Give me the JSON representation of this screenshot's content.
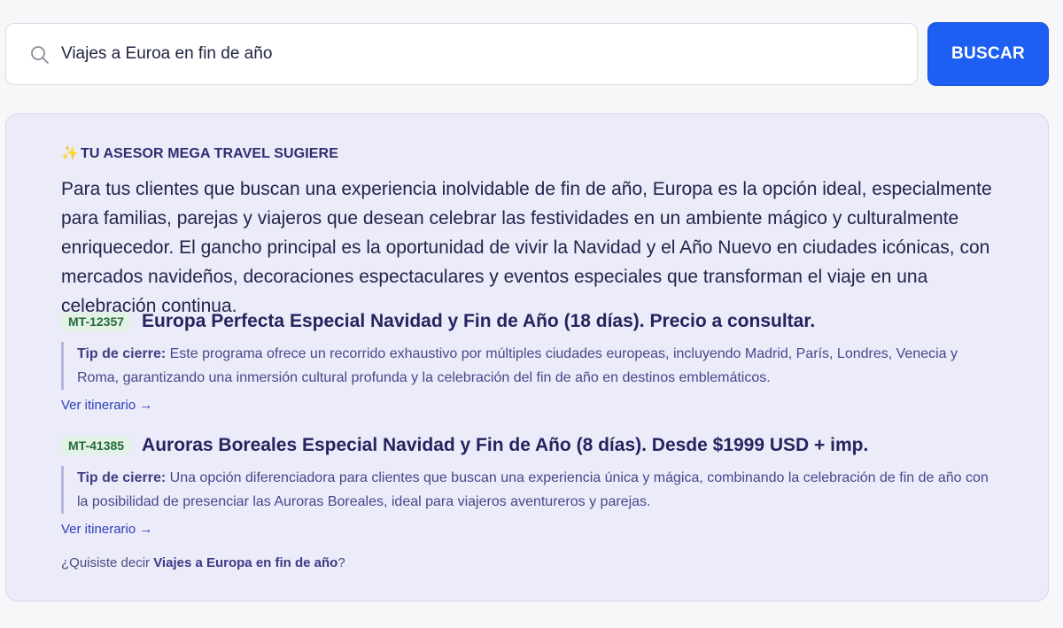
{
  "search": {
    "value": "Viajes a Euroa en fin de año",
    "button_label": "BUSCAR"
  },
  "advisor": {
    "label": "TU ASESOR MEGA TRAVEL SUGIERE",
    "sparkle": "✨",
    "intro": "Para tus clientes que buscan una experiencia inolvidable de fin de año, Europa es la opción ideal, especialmente para familias, parejas y viajeros que desean celebrar las festividades en un ambiente mágico y culturalmente enriquecedor. El gancho principal es la oportunidad de vivir la Navidad y el Año Nuevo en ciudades icónicas, con mercados navideños, decoraciones espectaculares y eventos especiales que transforman el viaje en una celebración continua."
  },
  "results": [
    {
      "code": "MT-12357",
      "title": "Europa Perfecta Especial Navidad y Fin de Año (18 días). Precio a consultar.",
      "tip_label": "Tip de cierre:",
      "tip_text": " Este programa ofrece un recorrido exhaustivo por múltiples ciudades europeas, incluyendo Madrid, París, Londres, Venecia y Roma, garantizando una inmersión cultural profunda y la celebración del fin de año en destinos emblemáticos.",
      "link_label": "Ver itinerario →"
    },
    {
      "code": "MT-41385",
      "title": "Auroras Boreales Especial Navidad y Fin de Año (8 días). Desde $1999 USD + imp.",
      "tip_label": "Tip de cierre:",
      "tip_text": " Una opción diferenciadora para clientes que buscan una experiencia única y mágica, combinando la celebración de fin de año con la posibilidad de presenciar las Auroras Boreales, ideal para viajeros aventureros y parejas.",
      "link_label": "Ver itinerario →"
    }
  ],
  "suggestion": {
    "prefix": "¿Quisiste decir ",
    "link": "Viajes a Europa en fin de año",
    "suffix": "?"
  },
  "icons": {
    "search": "search-icon"
  },
  "colors": {
    "accent": "#1d5ff2",
    "panel_bg": "#ebebfa",
    "badge_bg": "#e3f2e6",
    "badge_text": "#236b3a"
  }
}
